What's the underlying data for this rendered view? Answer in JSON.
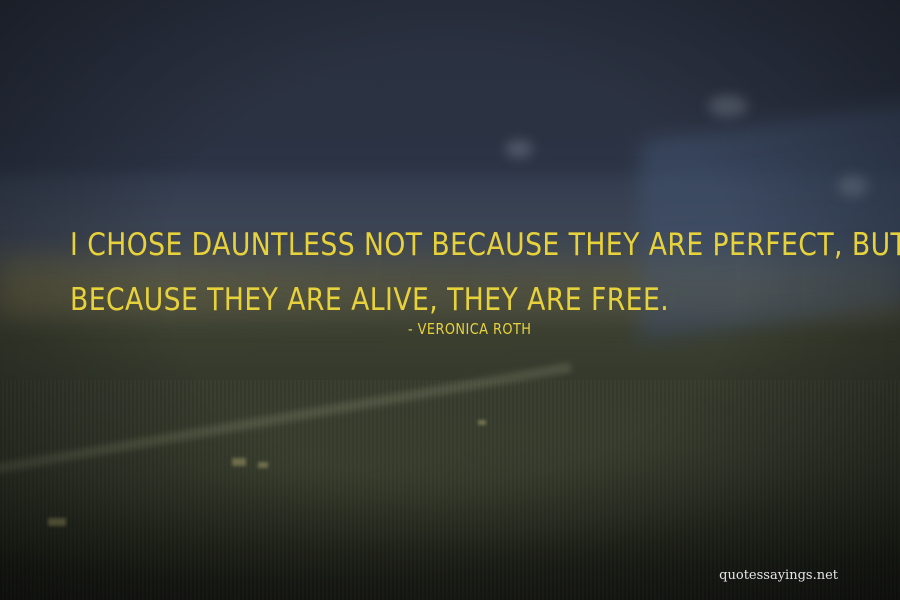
{
  "quote": {
    "lines": [
      "I CHOSE DAUNTLESS NOT BECAUSE THEY ARE PERFECT, BUT",
      "BECAUSE THEY ARE ALIVE, THEY ARE FREE."
    ],
    "color": "#e8d23c"
  },
  "author": {
    "text": "- VERONICA ROTH"
  },
  "watermark": {
    "text": "quotessayings.net"
  }
}
